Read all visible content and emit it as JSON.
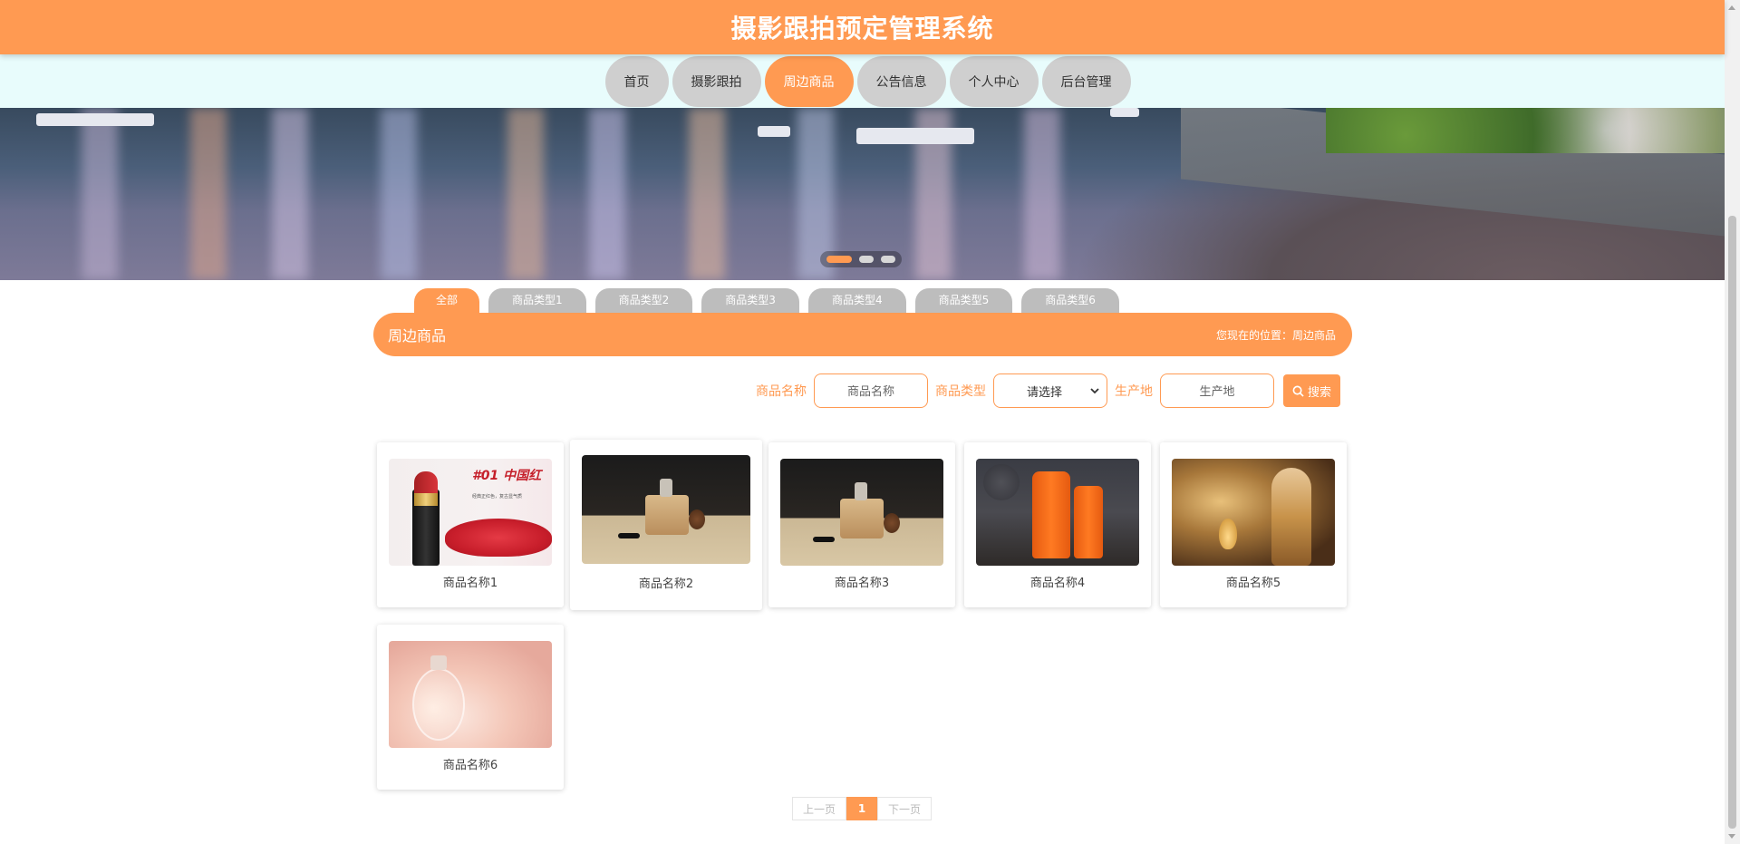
{
  "app": {
    "title": "摄影跟拍预定管理系统"
  },
  "nav": [
    {
      "label": "首页",
      "active": false
    },
    {
      "label": "摄影跟拍",
      "active": false
    },
    {
      "label": "周边商品",
      "active": true
    },
    {
      "label": "公告信息",
      "active": false
    },
    {
      "label": "个人中心",
      "active": false
    },
    {
      "label": "后台管理",
      "active": false
    }
  ],
  "banner": {
    "slides": 3,
    "active_slide": 1
  },
  "tabs": [
    "全部",
    "商品类型1",
    "商品类型2",
    "商品类型3",
    "商品类型4",
    "商品类型5",
    "商品类型6"
  ],
  "page": {
    "title": "周边商品",
    "location": "您现在的位置：周边商品"
  },
  "search": {
    "name_label": "商品名称",
    "name_placeholder": "商品名称",
    "type_label": "商品类型",
    "type_selected": "请选择",
    "origin_label": "生产地",
    "origin_placeholder": "生产地",
    "button_label": "搜索"
  },
  "products": [
    {
      "name": "商品名称1",
      "image": "lipstick"
    },
    {
      "name": "商品名称2",
      "image": "incense-burner"
    },
    {
      "name": "商品名称3",
      "image": "incense-burner"
    },
    {
      "name": "商品名称4",
      "image": "sunscreen"
    },
    {
      "name": "商品名称5",
      "image": "perfume-ad"
    },
    {
      "name": "商品名称6",
      "image": "perfume-bottle"
    }
  ],
  "lipstick_text": {
    "headline": "#01 中国红",
    "sub": "经典正红色，复古显气质"
  },
  "pagination": {
    "prev": "上一页",
    "current": "1",
    "next": "下一页"
  },
  "colors": {
    "accent": "#ff9a52",
    "nav_bg": "#e8fcfc",
    "inactive": "#cfcfcf"
  }
}
